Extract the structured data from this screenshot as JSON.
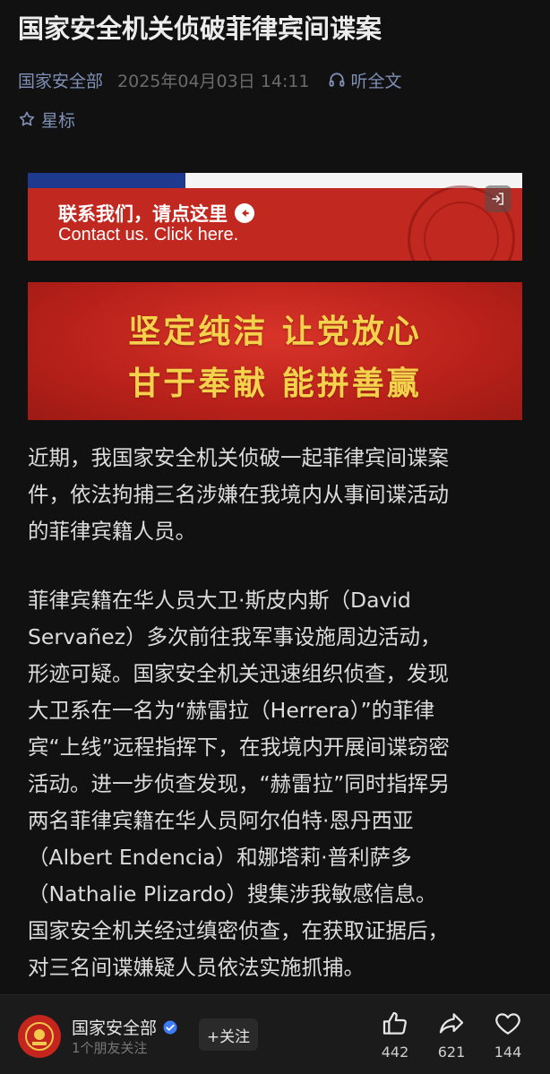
{
  "article": {
    "title": "国家安全机关侦破菲律宾间谍案",
    "source": "国家安全部",
    "date": "2025年04月03日  14:11",
    "listen_label": "听全文",
    "star_label": "星标"
  },
  "banner_contact": {
    "cn": "联系我们，请点这里",
    "en": "Contact us. Click here."
  },
  "banner_slogan": {
    "line1": "坚定纯洁 让党放心",
    "line2": "甘于奉献 能拼善赢"
  },
  "paragraphs": [
    {
      "lines": [
        "近期，我国家安全机关侦破一起菲律宾间谍案",
        "件，依法拘捕三名涉嫌在我境内从事间谍活动",
        "的菲律宾籍人员。"
      ]
    },
    {
      "lines": [
        "菲律宾籍在华人员大卫·斯皮内斯（David",
        "Servañez）多次前往我军事设施周边活动，",
        "形迹可疑。国家安全机关迅速组织侦查，发现",
        "大卫系在一名为“赫雷拉（Herrera）”的菲律",
        "宾“上线”远程指挥下，在我境内开展间谍窃密",
        "活动。进一步侦查发现，“赫雷拉”同时指挥另",
        "两名菲律宾籍在华人员阿尔伯特·恩丹西亚",
        "（Albert Endencia）和娜塔莉·普利萨多",
        "（Nathalie Plizardo）搜集涉我敏感信息。",
        "国家安全机关经过缜密侦查，在获取证据后，",
        "对三名间谍嫌疑人员依法实施抓捕。"
      ]
    }
  ],
  "bottom_bar": {
    "account_name": "国家安全部",
    "account_sub": "1个朋友关注",
    "follow_label": "+关注",
    "like_count": "442",
    "share_count": "621",
    "fav_count": "144"
  },
  "colors": {
    "background": "#111111",
    "link_blue": "#7f8fb5",
    "banner_red": "#c1281f",
    "slogan_gold": "#f5d24b",
    "verified_blue": "#3d7cf5"
  }
}
